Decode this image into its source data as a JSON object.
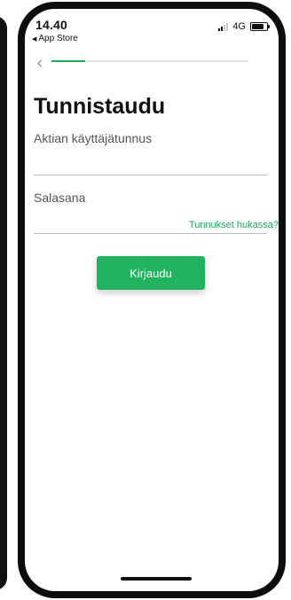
{
  "status_bar": {
    "time": "14.40",
    "back_app": "App Store",
    "network": "4G",
    "signal_strength": 0.5,
    "battery_level": 0.8
  },
  "nav": {
    "back_icon": "chevron-left-icon",
    "progress_fraction": 0.17,
    "accent_color": "#1fa95a"
  },
  "login": {
    "title": "Tunnistaudu",
    "username_label": "Aktian käyttäjätunnus",
    "username_value": "",
    "password_label": "Salasana",
    "password_value": "",
    "forgot_link": "Tunnukset hukassa?",
    "submit_label": "Kirjaudu",
    "button_color": "#21b35f"
  }
}
